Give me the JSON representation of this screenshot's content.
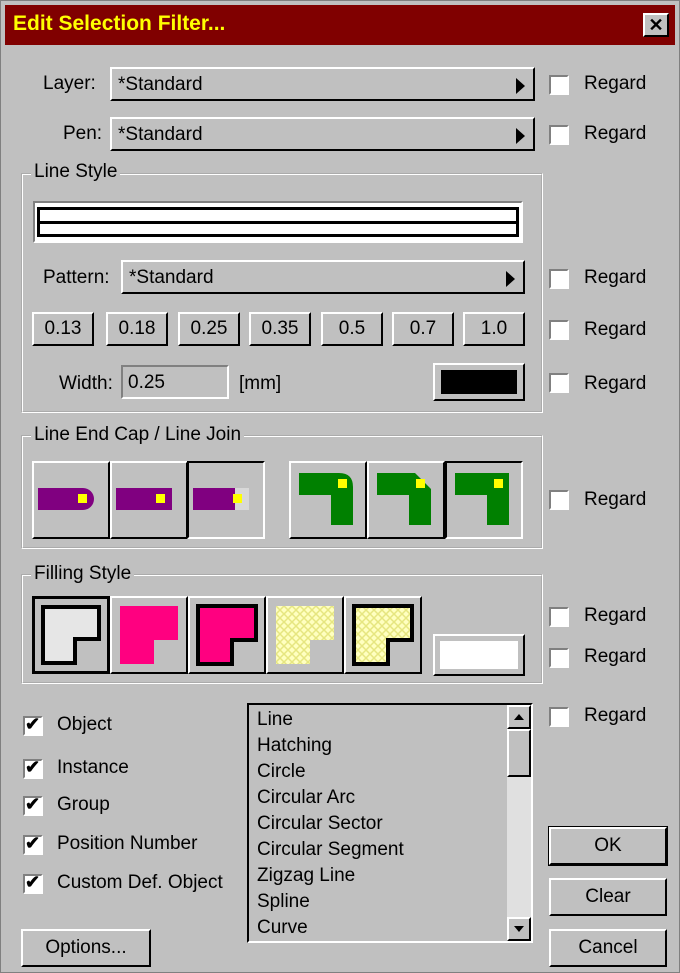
{
  "window": {
    "title": "Edit Selection Filter...",
    "close_glyph": "✕"
  },
  "regard_label": "Regard",
  "layer": {
    "label": "Layer:",
    "value": "*Standard",
    "regard_checked": false
  },
  "pen": {
    "label": "Pen:",
    "value": "*Standard",
    "regard_checked": false
  },
  "line_style": {
    "title": "Line Style",
    "pattern_label": "Pattern:",
    "pattern_value": "*Standard",
    "widths": [
      "0.13",
      "0.18",
      "0.25",
      "0.35",
      "0.5",
      "0.7",
      "1.0"
    ],
    "width_label": "Width:",
    "width_value": "0.25",
    "width_unit": "[mm]",
    "color": "#000000"
  },
  "end_cap": {
    "title": "Line End Cap / Line Join",
    "cap_color": "#800080",
    "join_color": "#008000",
    "marker_color": "#ffff00"
  },
  "filling": {
    "title": "Filling Style",
    "fill_color": "#ff0080",
    "hatch_color": "#ffff80"
  },
  "object_types": [
    {
      "label": "Object",
      "checked": true
    },
    {
      "label": "Instance",
      "checked": true
    },
    {
      "label": "Group",
      "checked": true
    },
    {
      "label": "Position Number",
      "checked": true
    },
    {
      "label": "Custom Def. Object",
      "checked": true
    }
  ],
  "element_list": [
    "Line",
    "Hatching",
    "Circle",
    "Circular Arc",
    "Circular Sector",
    "Circular Segment",
    "Zigzag Line",
    "Spline",
    "Curve"
  ],
  "buttons": {
    "options": "Options...",
    "ok": "OK",
    "clear": "Clear",
    "cancel": "Cancel"
  }
}
